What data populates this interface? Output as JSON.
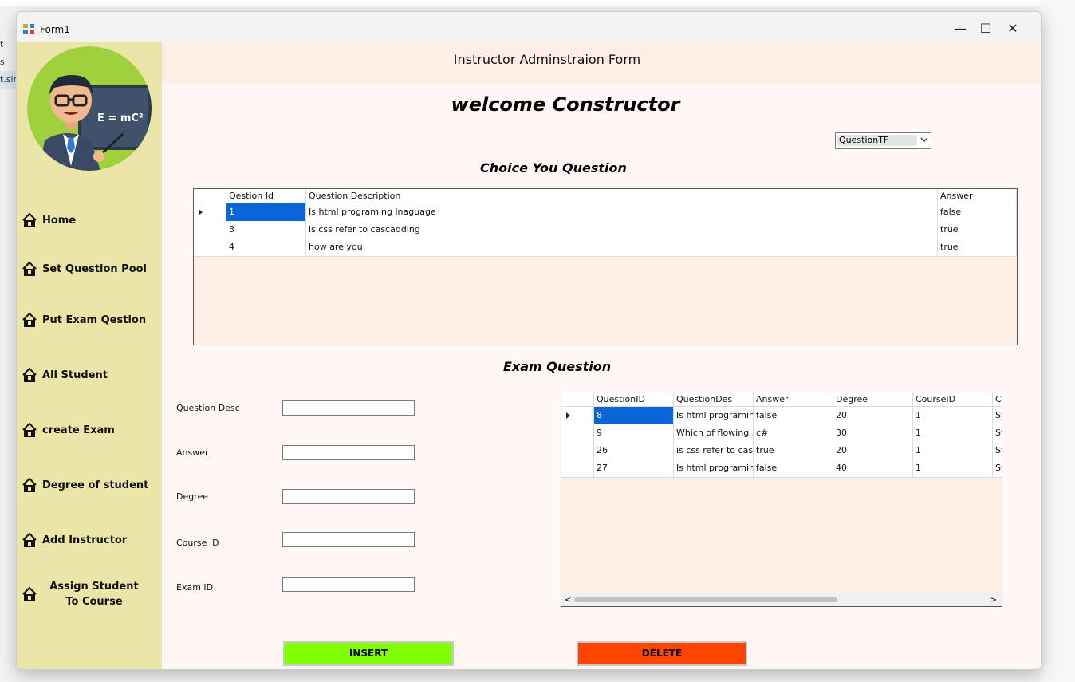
{
  "window": {
    "title": "Form1",
    "controls": {
      "minimize": "—",
      "maximize": "☐",
      "close": "✕"
    }
  },
  "background": {
    "side_items": [
      "t",
      "s",
      "t.sln"
    ]
  },
  "sidebar": {
    "items": [
      {
        "label": "Home"
      },
      {
        "label": "Set Question Pool"
      },
      {
        "label": "Put Exam Qestion"
      },
      {
        "label": "All Student"
      },
      {
        "label": "create Exam"
      },
      {
        "label": "Degree of student"
      },
      {
        "label": "Add Instructor"
      },
      {
        "label": "Assign Student To Course"
      }
    ]
  },
  "header": {
    "title": "Instructor Adminstraion Form"
  },
  "welcome": "welcome Constructor",
  "question_type": {
    "selected": "QuestionTF"
  },
  "choice_section": {
    "title": "Choice You Question",
    "columns": [
      "Qestion Id",
      "Question Description",
      "Answer"
    ],
    "rows": [
      [
        "1",
        "Is html programing lnaguage",
        "false"
      ],
      [
        "3",
        "is css refer to cascadding",
        "true"
      ],
      [
        "4",
        "how are you",
        "true"
      ]
    ]
  },
  "exam_section": {
    "title": "Exam Question",
    "columns": [
      "QuestionID",
      "QuestionDes",
      "Answer",
      "Degree",
      "CourseID",
      "C"
    ],
    "rows": [
      [
        "8",
        "Is html programin...",
        "false",
        "20",
        "1",
        "Sy"
      ],
      [
        "9",
        "Which of flowing ...",
        "c#",
        "30",
        "1",
        "Sy"
      ],
      [
        "26",
        "is css refer to cas...",
        "true",
        "20",
        "1",
        "Sy"
      ],
      [
        "27",
        "Is html programin...",
        "false",
        "40",
        "1",
        "Sy"
      ]
    ]
  },
  "form": {
    "fields": [
      {
        "label": "Question Desc",
        "value": ""
      },
      {
        "label": "Answer",
        "value": ""
      },
      {
        "label": "Degree",
        "value": ""
      },
      {
        "label": "Course ID",
        "value": ""
      },
      {
        "label": "Exam ID",
        "value": ""
      }
    ]
  },
  "buttons": {
    "insert": "INSERT",
    "delete": "DELETE"
  },
  "colors": {
    "insert": "#7fff00",
    "delete": "#ff4500",
    "sidebar": "#ece5a8",
    "header": "#feeee5",
    "selection": "#0a66d8"
  }
}
